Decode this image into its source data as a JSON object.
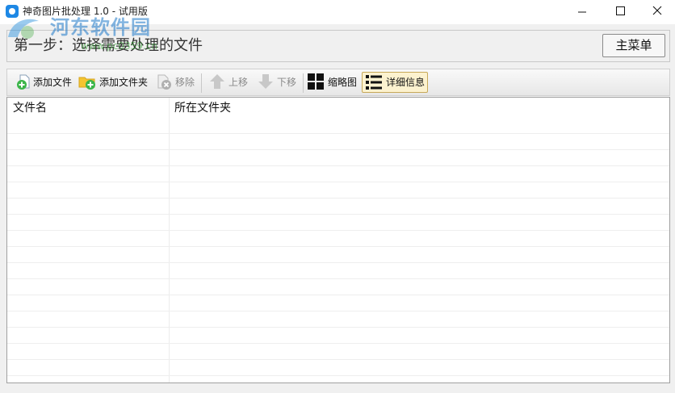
{
  "window": {
    "title": "神奇图片批处理 1.0 - 试用版",
    "controls": [
      "minimize",
      "maximize",
      "close"
    ]
  },
  "watermark": {
    "text": "河东软件园",
    "url": "www.pc0359.cn"
  },
  "header": {
    "step_text": "第一步：选择需要处理的文件",
    "main_menu_label": "主菜单"
  },
  "toolbar": {
    "add_file": "添加文件",
    "add_folder": "添加文件夹",
    "remove": "移除",
    "move_up": "上移",
    "move_down": "下移",
    "thumbnail": "缩略图",
    "details": "详细信息",
    "active_view": "details"
  },
  "list": {
    "columns": [
      "文件名",
      "所在文件夹"
    ],
    "rows": []
  },
  "colors": {
    "accent_green": "#3bb54a",
    "folder_yellow": "#f4c430",
    "active_bg": "#fcf2cf",
    "active_border": "#c7a959",
    "disabled_gray": "#a8a8a8"
  }
}
